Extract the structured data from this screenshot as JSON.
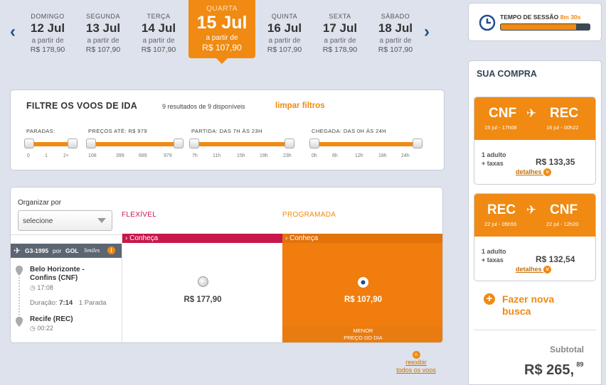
{
  "date_bar": {
    "prev_icon": "chevron-left-icon",
    "next_icon": "chevron-right-icon",
    "days": [
      {
        "dow": "DOMINGO",
        "date": "12 Jul",
        "from": "a partir de",
        "price": "R$ 178,90"
      },
      {
        "dow": "SEGUNDA",
        "date": "13 Jul",
        "from": "a partir de",
        "price": "R$ 107,90"
      },
      {
        "dow": "TERÇA",
        "date": "14 Jul",
        "from": "a partir de",
        "price": "R$ 107,90"
      },
      {
        "dow": "QUARTA",
        "date": "15 Jul",
        "from": "a partir de",
        "price": "R$ 107,90"
      },
      {
        "dow": "QUINTA",
        "date": "16 Jul",
        "from": "a partir de",
        "price": "R$ 107,90"
      },
      {
        "dow": "SEXTA",
        "date": "17 Jul",
        "from": "a partir de",
        "price": "R$ 178,90"
      },
      {
        "dow": "SÁBADO",
        "date": "18 Jul",
        "from": "a partir de",
        "price": "R$ 107,90"
      }
    ]
  },
  "session": {
    "label": "TEMPO DE SESSÃO",
    "time": "8m 30s",
    "progress_fraction": 0.85
  },
  "filters": {
    "title": "FILTRE OS VOOS DE IDA",
    "results": "9 resultados de 9 disponíveis",
    "clear": "limpar filtros",
    "groups": [
      {
        "label": "PARADAS:",
        "ticks": [
          "0",
          "1",
          "2+"
        ]
      },
      {
        "label": "PREÇOS ATÉ: R$ 979",
        "ticks": [
          "108",
          "399",
          "689",
          "979"
        ]
      },
      {
        "label": "PARTIDA: DAS 7H ÀS 23H",
        "ticks": [
          "7h",
          "11h",
          "15h",
          "19h",
          "23h"
        ]
      },
      {
        "label": "CHEGADA: DAS 0H ÀS 24H",
        "ticks": [
          "0h",
          "6h",
          "12h",
          "18h",
          "24h"
        ]
      }
    ]
  },
  "results": {
    "sort_label": "Organizar por",
    "sort_value": "selecione",
    "flexivel": "FLEXÍVEL",
    "programada": "PROGRAMADA",
    "conheca": "Conheça",
    "flight": {
      "number": "G3-1995",
      "por": "por",
      "airline": "GOL",
      "loyalty": "Smiles",
      "origin": "Belo Horizonte - Confins (CNF)",
      "dep_time": "17:08",
      "duration_label": "Duração:",
      "duration": "7:14",
      "stops": "1 Parada",
      "destination": "Recife (REC)",
      "arr_time": "00:22"
    },
    "price_flex": "R$ 177,90",
    "price_prog": "R$ 107,90",
    "menor_line1": "MENOR",
    "menor_line2": "PREÇO DO DIA",
    "reexibir_line1": "reexibir",
    "reexibir_line2": "todos os voos"
  },
  "compra": {
    "title": "SUA COMPRA",
    "outbound": {
      "from": "CNF",
      "to": "REC",
      "dep": "15 jul - 17h08",
      "arr": "16 jul - 00h22",
      "pax1": "1 adulto",
      "pax2": "+ taxas",
      "price": "R$ 133,35",
      "details": "detalhes"
    },
    "return": {
      "from": "REC",
      "to": "CNF",
      "dep": "22 jul - 05h55",
      "arr": "22 jul - 12h20",
      "pax1": "1 adulto",
      "pax2": "+ taxas",
      "price": "R$ 132,54",
      "details": "detalhes"
    },
    "new_search_line1": "Fazer nova",
    "new_search_line2": "busca",
    "subtotal_label": "Subtotal",
    "subtotal_int": "R$ 265,",
    "subtotal_cents": "89"
  },
  "colors": {
    "accent": "#f08a12",
    "flex": "#c8174a",
    "nav": "#1f4e8c"
  }
}
